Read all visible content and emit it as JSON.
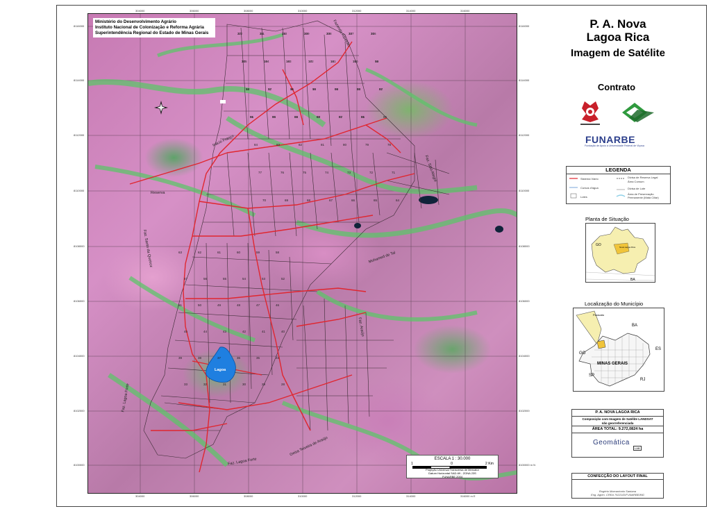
{
  "header": {
    "title_line1": "P. A. Nova",
    "title_line2": "Lagoa Rica",
    "title_line3": "Imagem de Satélite",
    "contrato": "Contrato"
  },
  "ministry": {
    "line1": "Ministério do Desenvolvimento Agrário",
    "line2": "Instituto Nacional de Colonização e Reforma Agrária",
    "line3": "Superintendência Regional do Estado de Minas Gerais"
  },
  "axes": {
    "top_ticks": [
      "304000",
      "306000",
      "308000",
      "310000",
      "312000",
      "314000",
      "316000"
    ],
    "bottom_ticks": [
      "304000",
      "306000",
      "308000",
      "310000",
      "312000",
      "314000",
      "316000 m E"
    ],
    "left_ticks": [
      "8116000",
      "8114000",
      "8112000",
      "8110000",
      "8108000",
      "8106000",
      "8104000",
      "8102000",
      "8100000"
    ],
    "right_ticks": [
      "8116000",
      "8114000",
      "8112000",
      "8110000",
      "8108000",
      "8106000",
      "8104000",
      "8102000",
      "8100000 m N"
    ]
  },
  "map_labels": {
    "lagoa": "Lagoa",
    "reserva": "Reserva",
    "faz_ribeirao": "Fazenda Ribeirão",
    "faz_santo": "Faz. Santo da Queiroz",
    "faz_lagoa_forte_w": "Faz. Lagoa Forte",
    "faz_lagoa_forte_s": "Faz. Lagoa Forte",
    "geraldo_teixeira": "Geisa Teixeira de Araújo",
    "mohamed": "Mohamed de Tal",
    "faz_araujo": "Faz. Araújo",
    "inacio_franco": "Inácio Franco",
    "faz_alegre": "Faz. Sítio Alegre"
  },
  "lot_numbers": [
    "112",
    "111",
    "110",
    "109",
    "108",
    "107",
    "106",
    "105",
    "104",
    "103",
    "102",
    "101",
    "100",
    "99",
    "98",
    "97",
    "96",
    "95",
    "94",
    "93",
    "92",
    "91",
    "90",
    "89",
    "88",
    "87",
    "86",
    "85",
    "84",
    "83",
    "82",
    "81",
    "80",
    "79",
    "78",
    "77",
    "76",
    "75",
    "74",
    "73",
    "72",
    "71",
    "70",
    "69",
    "68",
    "67",
    "66",
    "65",
    "64",
    "63",
    "62",
    "61",
    "60",
    "59",
    "58",
    "57",
    "56",
    "55",
    "54",
    "53",
    "52",
    "51",
    "50",
    "49",
    "48",
    "47",
    "46",
    "45",
    "44",
    "43",
    "42",
    "41",
    "40",
    "39",
    "38",
    "37",
    "36",
    "35",
    "34",
    "33",
    "32",
    "31",
    "30",
    "29",
    "28",
    "27",
    "26",
    "25",
    "24",
    "23",
    "22",
    "21",
    "20",
    "19",
    "18",
    "17",
    "16",
    "15",
    "14",
    "13",
    "12",
    "11",
    "10",
    "09",
    "08",
    "07",
    "06",
    "05",
    "04",
    "03",
    "02",
    "01"
  ],
  "scale": {
    "title": "ESCALA  1 : 30.000",
    "left": "1",
    "mid": "0",
    "right": "2 Km",
    "note1": "Projeção Universal Transversa de Mercator",
    "note2": "Datum Horizontal SAD-69 - ZONA 23S",
    "note3": "FUNARBE 2004"
  },
  "funarbe": {
    "name": "FUNARBE",
    "sub": "Fundação de Apoio à Universidade Federal de Viçosa"
  },
  "legend": {
    "title": "LEGENDA",
    "items": [
      "Sistema Viário",
      "Cursos d'água",
      "Lotes",
      "Divisa de Reserva Legal",
      "Área Comum",
      "Divisa de Lote",
      "Área de Preservação Permanente (Mata Ciliar)"
    ]
  },
  "planta": {
    "title": "Planta de Situação",
    "labels": [
      "GO",
      "BA",
      "Nova Lagoa Rica"
    ]
  },
  "localizacao": {
    "title": "Localização do Município",
    "labels": [
      "BA",
      "ES",
      "GO",
      "MINAS GERAIS",
      "SP",
      "RJ",
      "Paracatu"
    ]
  },
  "info": {
    "title": "P. A. NOVA LAGOA RICA",
    "desc1": "Composição com Imagem de Satélite LANDSAT",
    "desc2": "não georreferenciada",
    "area": "ÁREA TOTAL: 9.272,0824 ha",
    "geomatica": "Geomática",
    "lab": "LAB"
  },
  "confeccao": {
    "title": "CONFECÇÃO DO LAYOUT FINAL",
    "line1": "Rogério Marcantonio Santana",
    "line2": "Eng. Agrim. CREA 76221/D/FUNARBE/MG"
  },
  "colors": {
    "roads": "#e0262f",
    "lot_lines": "#3a2a33",
    "lagoa": "#1f7fe0",
    "funarbe": "#2c3f8c",
    "planta_fill": "#f6efb0"
  }
}
